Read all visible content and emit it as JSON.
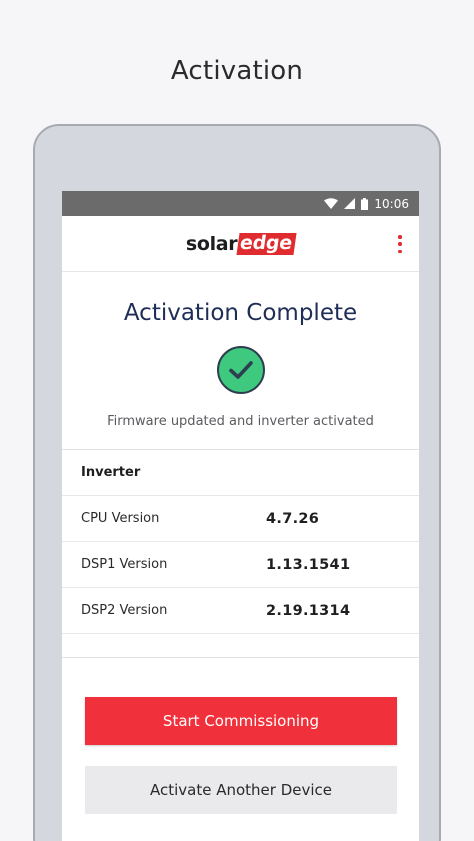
{
  "page": {
    "heading": "Activation"
  },
  "status_bar": {
    "time": "10:06",
    "icons": [
      "wifi-icon",
      "signal-icon",
      "battery-icon"
    ]
  },
  "app_bar": {
    "logo": {
      "part1": "solar",
      "part2": "edge"
    },
    "menu_icon": "more-vert-icon"
  },
  "main": {
    "title": "Activation Complete",
    "status_icon": "check-circle-icon",
    "subtitle": "Firmware updated and inverter activated",
    "table": {
      "header": "Inverter",
      "rows": [
        {
          "label": "CPU Version",
          "value": "4.7.26"
        },
        {
          "label": "DSP1 Version",
          "value": "1.13.1541"
        },
        {
          "label": "DSP2 Version",
          "value": "2.19.1314"
        }
      ]
    }
  },
  "actions": {
    "primary": "Start Commissioning",
    "secondary": "Activate Another Device"
  },
  "colors": {
    "brand_red": "#e02b2f",
    "primary_button": "#f0303a",
    "success_green": "#3ec97f",
    "title_navy": "#1f2e57"
  }
}
